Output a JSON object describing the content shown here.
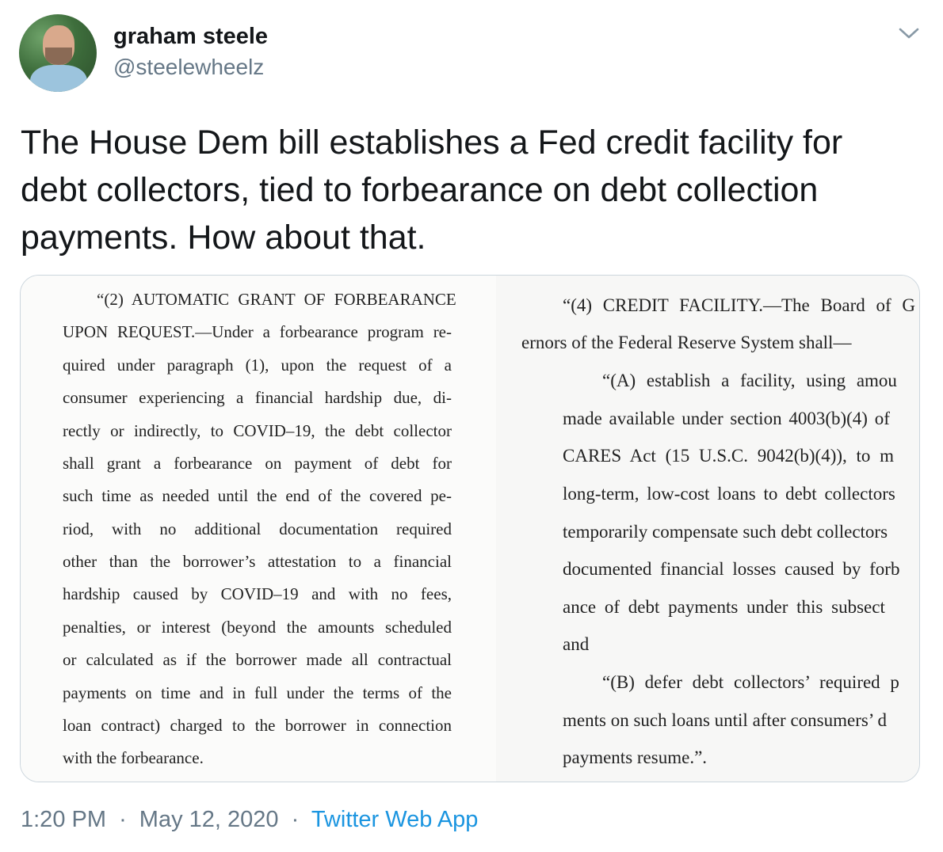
{
  "author": {
    "display_name": "graham steele",
    "handle": "@steelewheelz"
  },
  "icons": {
    "menu": "chevron-down-icon",
    "avatar": "profile-photo"
  },
  "tweet": {
    "text": "The House Dem bill establishes a Fed credit facility for\ndebt collectors, tied to forbearance on debt collection\npayments. How about that."
  },
  "document_image": {
    "left_column_lines": [
      "“(2) AUTOMATIC GRANT OF FORBEARANCE",
      "UPON REQUEST.—Under a forbearance program re-",
      "quired under paragraph (1), upon the request of a",
      "consumer experiencing a financial hardship due, di-",
      "rectly or indirectly, to COVID–19, the debt collector",
      "shall grant a forbearance on payment of debt for",
      "such time as needed until the end of the covered pe-",
      "riod, with no additional documentation required",
      "other than the borrower’s attestation to a financial",
      "hardship caused by COVID–19 and with no fees,",
      "penalties, or interest (beyond the amounts scheduled",
      "or calculated as if the borrower made all contractual",
      "payments on time and in full under the terms of the",
      "loan contract) charged to the borrower in connection",
      "with the forbearance."
    ],
    "right_column_lines": [
      "“(4) CREDIT FACILITY.—The Board of G",
      "ernors of the Federal Reserve System shall—",
      "“(A) establish a facility, using amou",
      "made available under section 4003(b)(4) of",
      "CARES Act (15 U.S.C. 9042(b)(4)), to m",
      "long-term, low-cost loans to debt collectors",
      "temporarily compensate such debt collectors",
      "documented financial losses caused by forb",
      "ance of debt payments under this subsect",
      "and",
      "“(B) defer debt collectors’ required p",
      "ments on such loans until after consumers’ d",
      "payments resume.”."
    ]
  },
  "footer": {
    "time": "1:20 PM",
    "separator": "·",
    "date": "May 12, 2020",
    "source": "Twitter Web App"
  },
  "colors": {
    "text_primary": "#14171a",
    "text_secondary": "#657786",
    "link": "#1b95e0",
    "border": "#ccd6dd"
  }
}
